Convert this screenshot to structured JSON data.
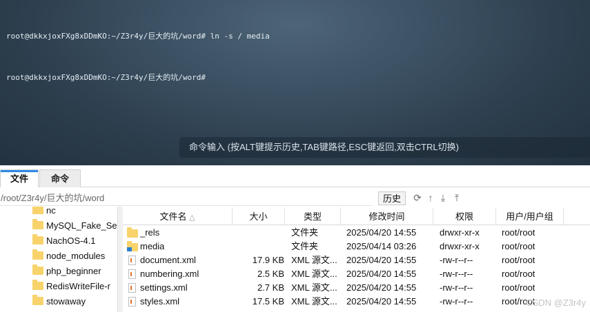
{
  "terminal": {
    "lines": [
      "root@dkkxjoxFXg8xDDmKO:~/Z3r4y/巨大的坑/word# ln -s / media",
      "root@dkkxjoxFXg8xDDmKO:~/Z3r4y/巨大的坑/word#"
    ],
    "input_hint": "命令输入 (按ALT键提示历史,TAB键路径,ESC键返回,双击CTRL切换)"
  },
  "tabs": [
    {
      "label": "文件",
      "active": true
    },
    {
      "label": "命令",
      "active": false
    }
  ],
  "pathbar": {
    "path": "/root/Z3r4y/巨大的坑/word",
    "history_label": "历史",
    "icons": [
      "refresh-icon",
      "up-arrow-icon",
      "download-icon",
      "upload-icon"
    ]
  },
  "tree": {
    "items": [
      "nc",
      "MySQL_Fake_Se",
      "NachOS-4.1",
      "node_modules",
      "php_beginner",
      "RedisWriteFile-r",
      "stowaway"
    ]
  },
  "table": {
    "headers": [
      "文件名",
      "大小",
      "类型",
      "修改时间",
      "权限",
      "用户/用户组"
    ],
    "rows": [
      {
        "name": "_rels",
        "size": "",
        "type": "文件夹",
        "mtime": "2025/04/20 14:55",
        "perm": "drwxr-xr-x",
        "owner": "root/root",
        "icon": "folder-icon"
      },
      {
        "name": "media",
        "size": "",
        "type": "文件夹",
        "mtime": "2025/04/14 03:26",
        "perm": "drwxr-xr-x",
        "owner": "root/root",
        "icon": "folder-link-icon"
      },
      {
        "name": "document.xml",
        "size": "17.9 KB",
        "type": "XML 源文...",
        "mtime": "2025/04/20 14:55",
        "perm": "-rw-r--r--",
        "owner": "root/root",
        "icon": "xml-file-icon"
      },
      {
        "name": "numbering.xml",
        "size": "2.5 KB",
        "type": "XML 源文...",
        "mtime": "2025/04/20 14:55",
        "perm": "-rw-r--r--",
        "owner": "root/root",
        "icon": "xml-file-icon"
      },
      {
        "name": "settings.xml",
        "size": "2.7 KB",
        "type": "XML 源文...",
        "mtime": "2025/04/20 14:55",
        "perm": "-rw-r--r--",
        "owner": "root/root",
        "icon": "xml-file-icon"
      },
      {
        "name": "styles.xml",
        "size": "17.5 KB",
        "type": "XML 源文...",
        "mtime": "2025/04/20 14:55",
        "perm": "-rw-r--r--",
        "owner": "root/root",
        "icon": "xml-file-icon"
      }
    ]
  },
  "watermark": "CSDN @Z3r4y",
  "colors": {
    "accent": "#2d8be5",
    "folder": "#f8d36b",
    "xml": "#e36f2c"
  }
}
